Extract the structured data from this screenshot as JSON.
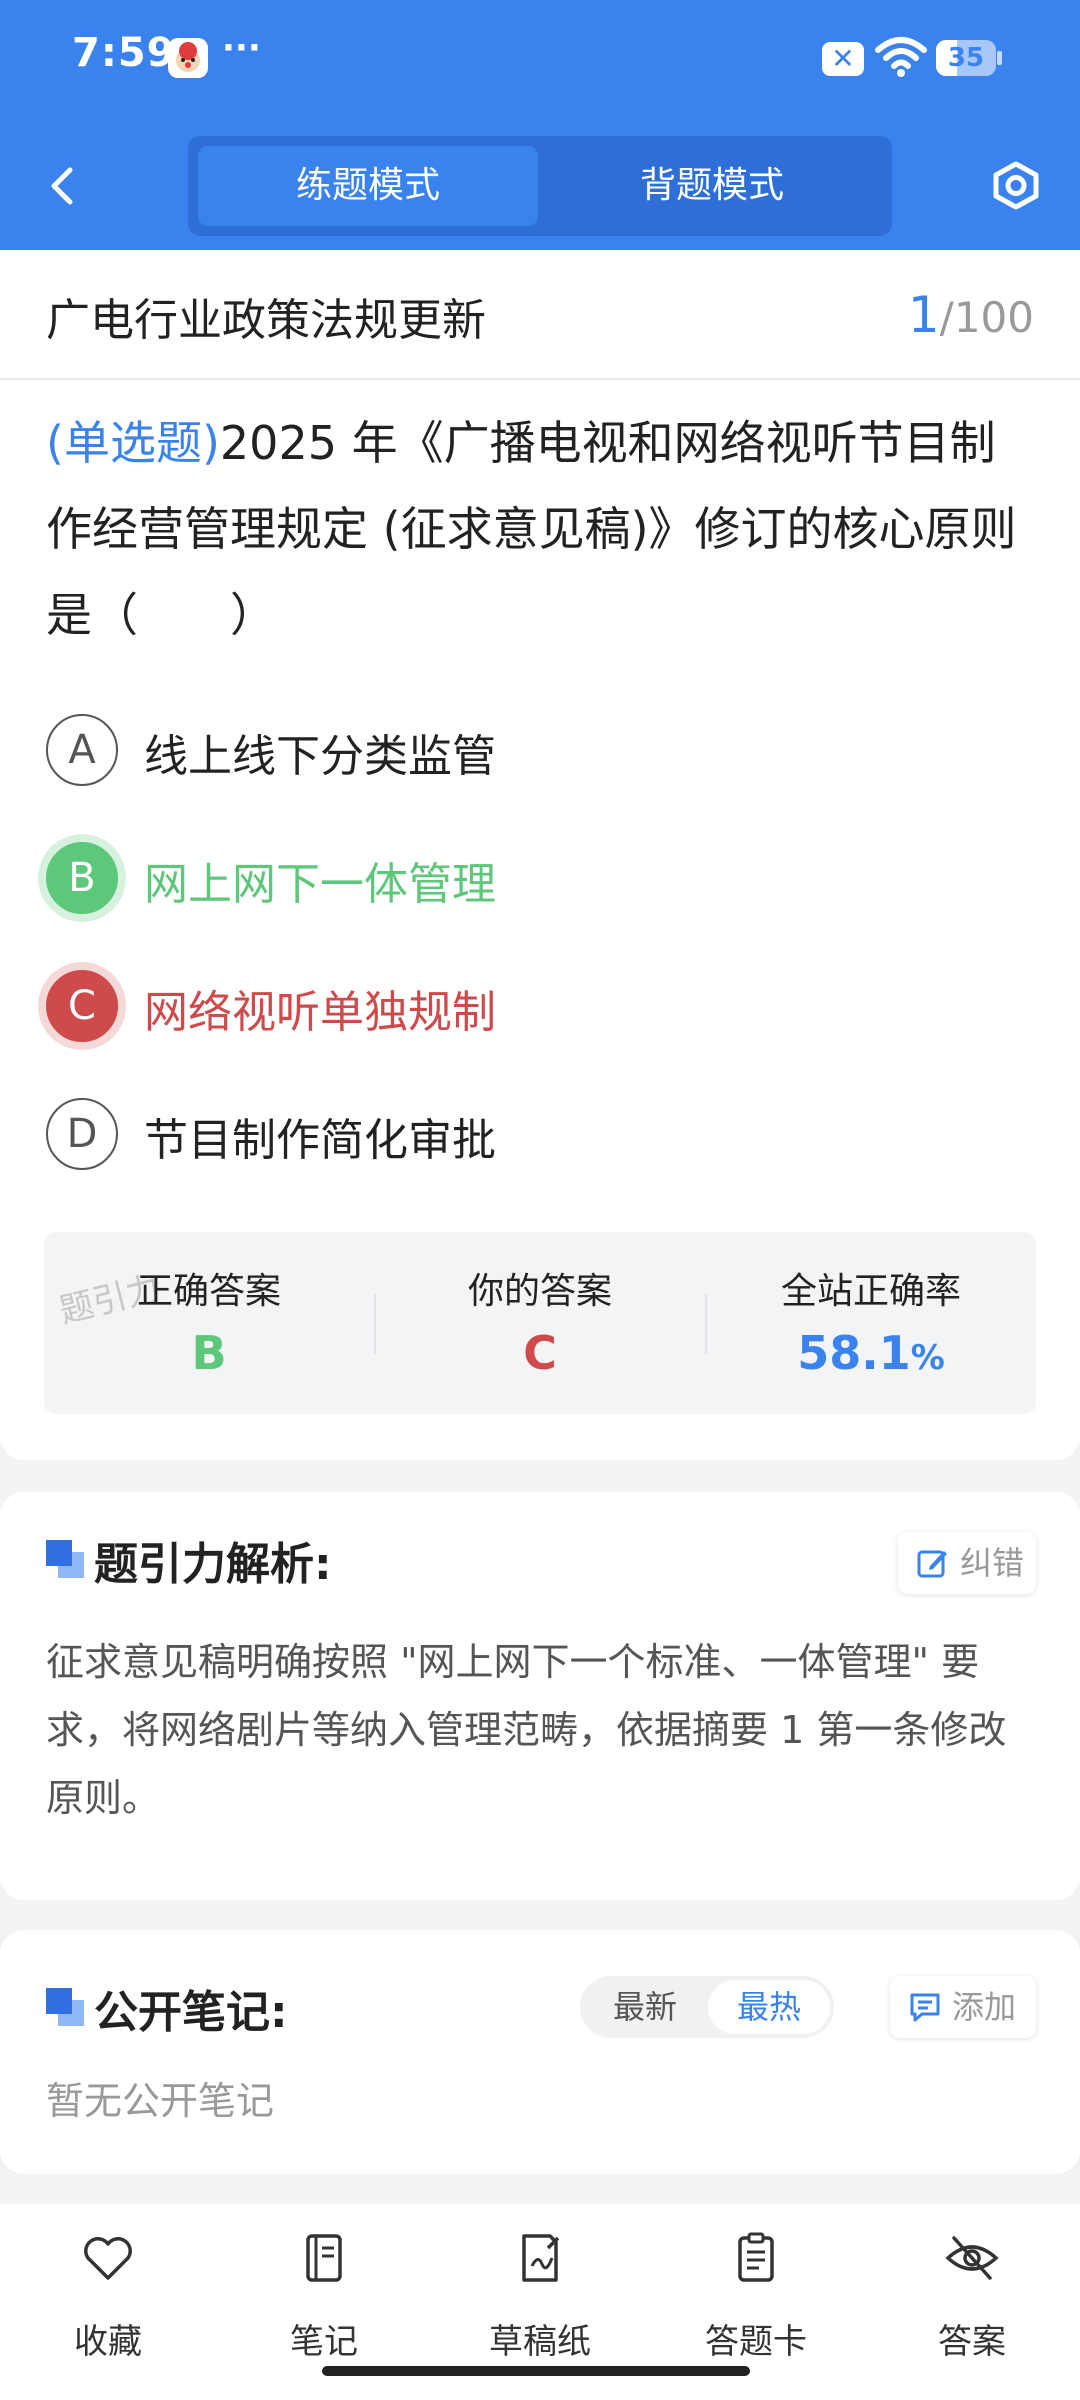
{
  "status_bar": {
    "time": "7:59",
    "more": "···",
    "battery_level": "35",
    "battery_fraction": 0.35
  },
  "header": {
    "tabs": [
      {
        "label": "练题模式",
        "active": true
      },
      {
        "label": "背题模式",
        "active": false
      }
    ]
  },
  "question_card": {
    "category": "广电行业政策法规更新",
    "progress_current": "1",
    "progress_total": "/100",
    "question_type": "(单选题)",
    "question_text": "2025 年《广播电视和网络视听节目制作经营管理规定 (征求意见稿)》修订的核心原则是（　　）",
    "options": [
      {
        "letter": "A",
        "text": "线上线下分类监管",
        "state": "normal"
      },
      {
        "letter": "B",
        "text": "网上网下一体管理",
        "state": "correct"
      },
      {
        "letter": "C",
        "text": "网络视听单独规制",
        "state": "wrong"
      },
      {
        "letter": "D",
        "text": "节目制作简化审批",
        "state": "normal"
      }
    ],
    "answer_panel": {
      "watermark": "题引力",
      "correct_label": "正确答案",
      "correct_value": "B",
      "yours_label": "你的答案",
      "yours_value": "C",
      "rate_label": "全站正确率",
      "rate_value": "58.1",
      "rate_unit": "%"
    }
  },
  "analysis": {
    "title": "题引力解析:",
    "report_label": "纠错",
    "text": "征求意见稿明确按照 \"网上网下一个标准、一体管理\" 要求，将网络剧片等纳入管理范畴，依据摘要 1 第一条修改原则。"
  },
  "notes": {
    "title": "公开笔记:",
    "sort_options": [
      "最新",
      "最热"
    ],
    "active_sort": "最热",
    "add_label": "添加",
    "empty_text": "暂无公开笔记"
  },
  "bottom_nav": [
    {
      "label": "收藏",
      "icon": "heart-icon"
    },
    {
      "label": "笔记",
      "icon": "notebook-icon"
    },
    {
      "label": "草稿纸",
      "icon": "draft-paper-icon"
    },
    {
      "label": "答题卡",
      "icon": "answer-card-icon"
    },
    {
      "label": "答案",
      "icon": "eye-off-icon"
    }
  ],
  "colors": {
    "primary": "#3a83ef",
    "correct": "#5dc77a",
    "wrong": "#cf4b4b"
  }
}
